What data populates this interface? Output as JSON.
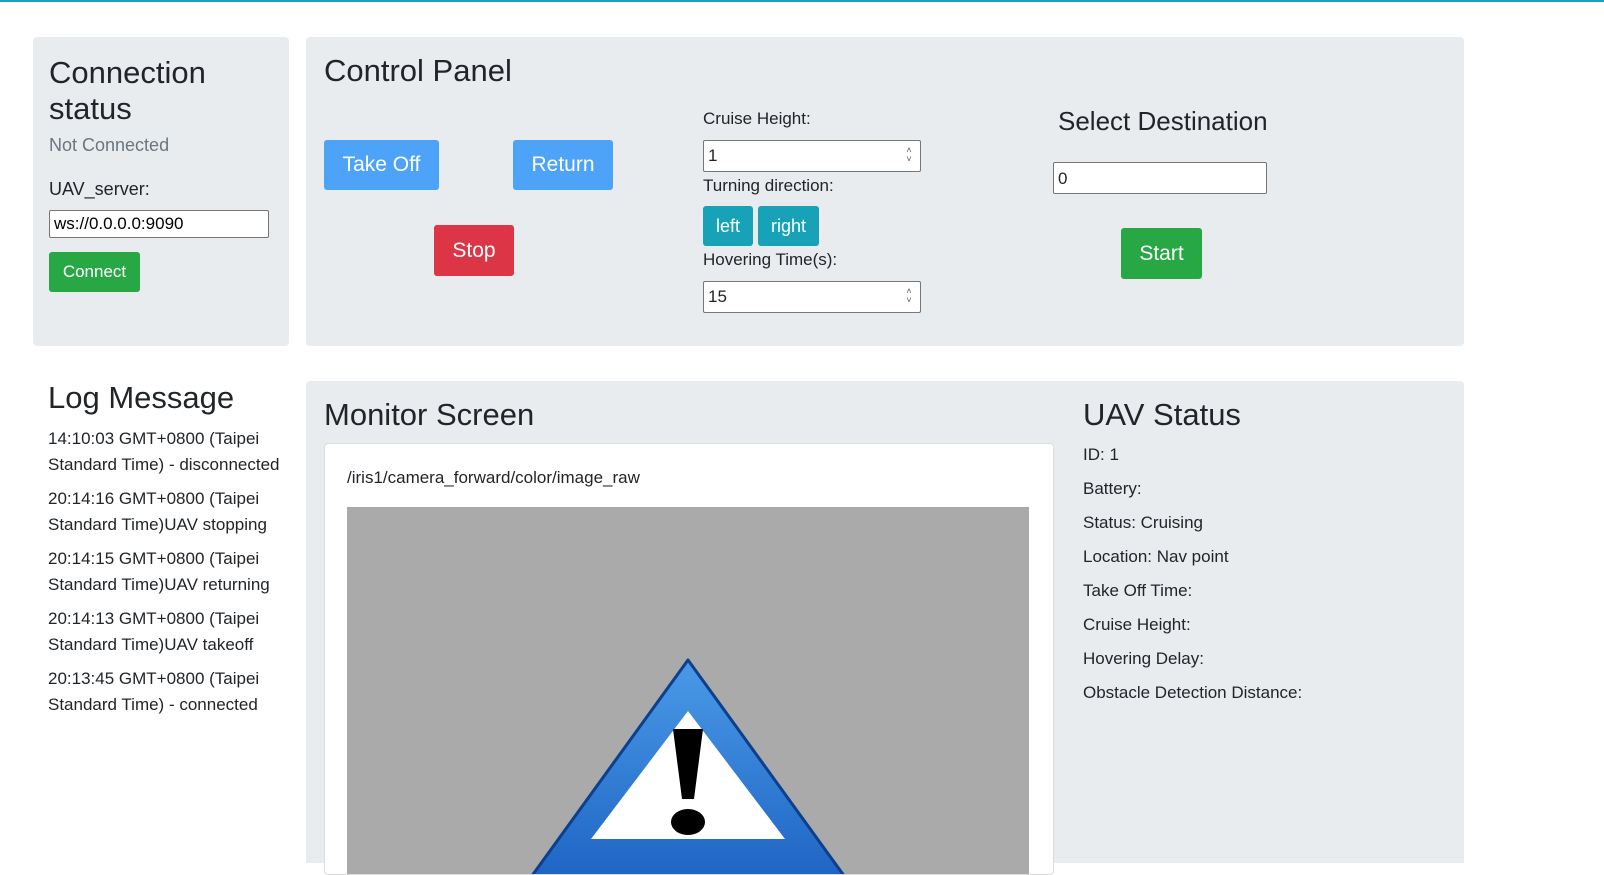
{
  "connection": {
    "title": "Connection status",
    "status": "Not Connected",
    "server_label": "UAV_server:",
    "server_value": "ws://0.0.0.0:9090",
    "connect_label": "Connect"
  },
  "control": {
    "title": "Control Panel",
    "takeoff_label": "Take Off",
    "return_label": "Return",
    "stop_label": "Stop",
    "cruise_height_label": "Cruise Height:",
    "cruise_height_value": "1",
    "turning_label": "Turning direction:",
    "left_label": "left",
    "right_label": "right",
    "hover_label": "Hovering Time(s):",
    "hover_value": "15",
    "destination_title": "Select Destination",
    "destination_value": "0",
    "start_label": "Start"
  },
  "log": {
    "title": "Log Message",
    "entries": [
      "14:10:03 GMT+0800 (Taipei Standard Time) - disconnected",
      "20:14:16 GMT+0800 (Taipei Standard Time)UAV stopping",
      "20:14:15 GMT+0800 (Taipei Standard Time)UAV returning",
      "20:14:13 GMT+0800 (Taipei Standard Time)UAV takeoff",
      "20:13:45 GMT+0800 (Taipei Standard Time) - connected"
    ]
  },
  "monitor": {
    "title": "Monitor Screen",
    "topic": "/iris1/camera_forward/color/image_raw",
    "image_icon": "warning-icon"
  },
  "uav_status": {
    "title": "UAV Status",
    "id": "ID: 1",
    "battery": "Battery:",
    "status": "Status: Cruising",
    "location": "Location: Nav point",
    "takeoff_time": "Take Off Time:",
    "cruise_height": "Cruise Height:",
    "hovering_delay": "Hovering Delay:",
    "obstacle_distance": "Obstacle Detection Distance:"
  },
  "colors": {
    "panel": "#e9ecef",
    "success": "#28a745",
    "primary": "#4da3f7",
    "danger": "#dc3545",
    "info": "#17a2b8"
  }
}
